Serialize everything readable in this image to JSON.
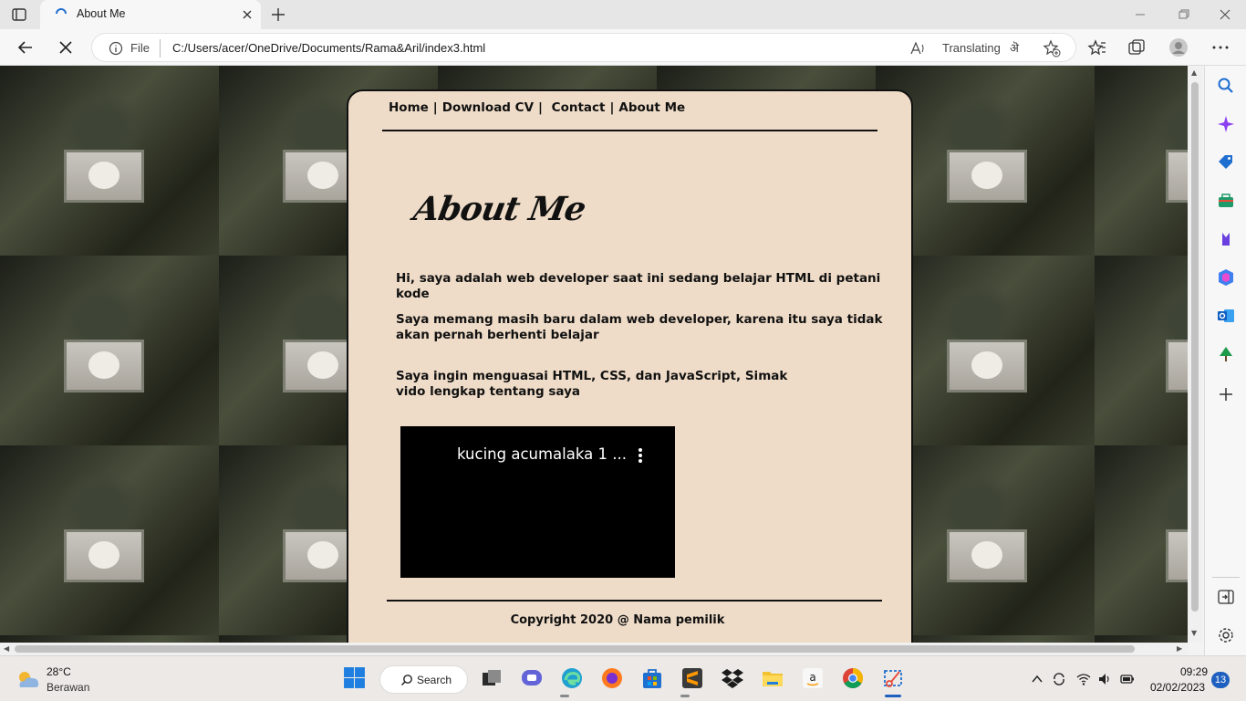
{
  "browser": {
    "tab_title": "About Me",
    "address_scheme": "File",
    "address_url": "C:/Users/acer/OneDrive/Documents/Rama&Aril/index3.html",
    "translating_label": "Translating",
    "translate_glyph": "ऄ"
  },
  "page": {
    "nav": {
      "home": "Home",
      "download_cv": "Download CV",
      "contact": "Contact",
      "about_me": "About Me",
      "sep": "|"
    },
    "title": "About Me",
    "paragraphs": [
      "Hi, saya adalah web developer saat ini sedang belajar HTML di petani kode",
      "Saya memang masih baru dalam web developer, karena itu saya tidak akan pernah berhenti belajar",
      "Saya ingin menguasai HTML, CSS, dan JavaScript, Simak vido lengkap tentang saya"
    ],
    "video_title": "kucing acumalaka 1 ...",
    "copyright": "Copyright 2020 @ Nama pemilik"
  },
  "taskbar": {
    "weather_temp": "28°C",
    "weather_desc": "Berawan",
    "search_label": "Search",
    "time": "09:29",
    "date": "02/02/2023",
    "notification_count": "13"
  },
  "colors": {
    "card_bg": "#efdcc8",
    "accent": "#1f5fbf"
  }
}
